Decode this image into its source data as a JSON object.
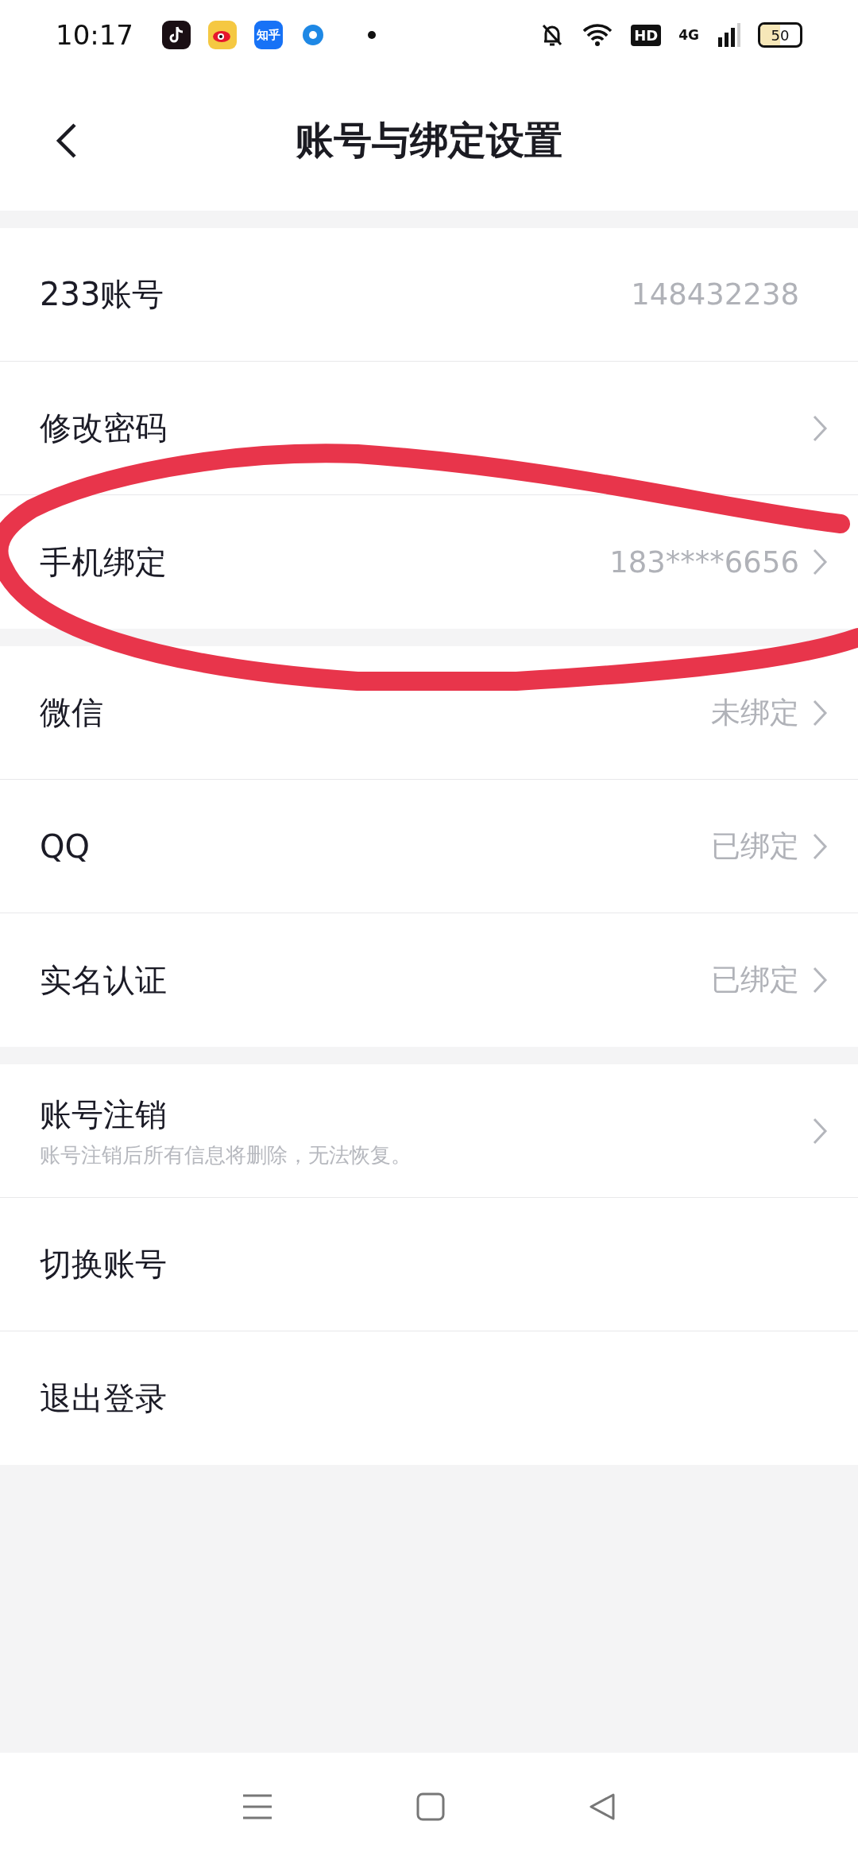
{
  "status_bar": {
    "time": "10:17",
    "notification_icons": [
      {
        "kind": "note"
      },
      {
        "kind": "eye"
      },
      {
        "kind": "text",
        "label": "知乎"
      },
      {
        "kind": "ring"
      },
      {
        "kind": "dot"
      }
    ],
    "hd": "HD",
    "network": "4G",
    "battery": "50"
  },
  "header": {
    "title": "账号与绑定设置"
  },
  "sections": [
    {
      "rows": [
        {
          "label": "233账号",
          "value": "148432238",
          "chevron": false
        },
        {
          "label": "修改密码",
          "chevron": true
        },
        {
          "label": "手机绑定",
          "value": "183****6656",
          "chevron": true
        }
      ]
    },
    {
      "rows": [
        {
          "label": "微信",
          "value": "未绑定",
          "chevron": true
        },
        {
          "label": "QQ",
          "value": "已绑定",
          "chevron": true
        },
        {
          "label": "实名认证",
          "value": "已绑定",
          "chevron": true
        }
      ]
    },
    {
      "rows": [
        {
          "label": "账号注销",
          "subtitle": "账号注销后所有信息将删除，无法恢复。",
          "chevron": true
        },
        {
          "label": "切换账号",
          "chevron": false
        },
        {
          "label": "退出登录",
          "chevron": false
        }
      ]
    }
  ],
  "annotation": {
    "kind": "circle",
    "color": "#e8354b"
  }
}
